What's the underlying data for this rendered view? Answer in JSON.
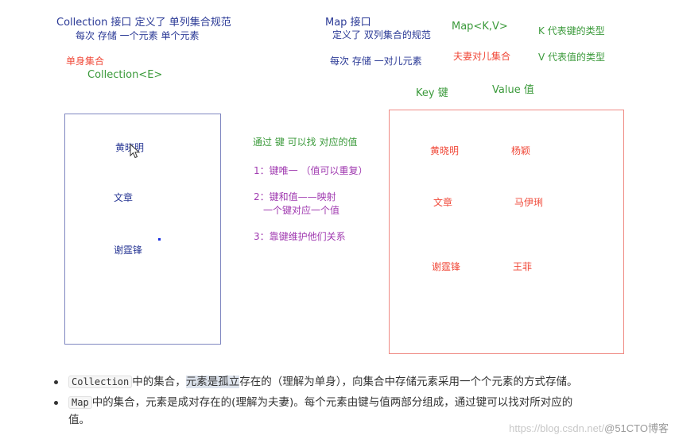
{
  "collection": {
    "line1": "Collection 接口  定义了 单列集合规范",
    "line2": "每次 存储 一个元素   单个元素",
    "single_label": "单身集合",
    "generic": "Collection<E>",
    "items": [
      "黄晓明",
      "文章",
      "谢霆锋"
    ]
  },
  "map": {
    "line1": "Map 接口",
    "line2": "定义了 双列集合的规范",
    "line3": "每次 存储 一对儿元素",
    "generic": "Map<K,V>",
    "couple_label": "夫妻对儿集合",
    "k_desc": "K 代表键的类型",
    "v_desc": "V 代表值的类型",
    "key_label": "Key   键",
    "value_label": "Value   值",
    "keys": [
      "黄晓明",
      "文章",
      "谢霆锋"
    ],
    "values": [
      "杨颖",
      "马伊琍",
      "王菲"
    ]
  },
  "notes": {
    "title": "通过 键 可以找 对应的值",
    "n1": "1：键唯一  （值可以重复）",
    "n2a": "2：键和值——映射",
    "n2b": "一个键对应一个值",
    "n3": "3：靠键维护他们关系"
  },
  "bullets": {
    "b1_code": "Collection",
    "b1_pre": "中的集合，",
    "b1_hl": "元素是孤立",
    "b1_post": "存在的（理解为单身），向集合中存储元素采用一个个元素的方式存储。",
    "b2_code": "Map",
    "b2_text": "中的集合，元素是成对存在的(理解为夫妻)。每个元素由键与值两部分组成，通过键可以找对所对应的",
    "b2_wrap": "值。"
  },
  "watermark": {
    "url": "https://blog.csdn.net/",
    "brand": "@51CTO博客"
  }
}
